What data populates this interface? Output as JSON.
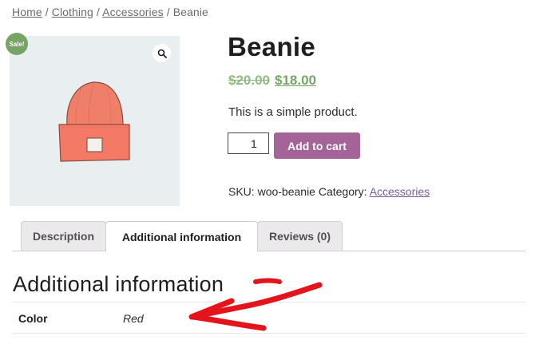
{
  "breadcrumb": {
    "home": "Home",
    "sep": "/",
    "clothing": "Clothing",
    "accessories": "Accessories",
    "current": "Beanie"
  },
  "product": {
    "title": "Beanie",
    "old_price": "$20.00",
    "price": "$18.00",
    "sale_badge": "Sale!",
    "short_description": "This is a simple product.",
    "quantity": "1",
    "add_to_cart_label": "Add to cart",
    "sku_label": "SKU:",
    "sku": "woo-beanie",
    "category_label": "Category:",
    "category": "Accessories",
    "image_alt": "beanie",
    "zoom_icon": "magnifier-icon"
  },
  "tabs": [
    {
      "label": "Description"
    },
    {
      "label": "Additional information"
    },
    {
      "label": "Reviews (0)"
    }
  ],
  "active_tab": "Additional information",
  "additional_info": {
    "heading": "Additional information",
    "attributes": [
      {
        "label": "Color",
        "value": "Red"
      }
    ]
  },
  "colors": {
    "sale_green": "#77a464",
    "price_green": "#77a464",
    "button_purple": "#a46497",
    "link_purple": "#7e5aa2",
    "annotation_red": "#e3141b"
  }
}
